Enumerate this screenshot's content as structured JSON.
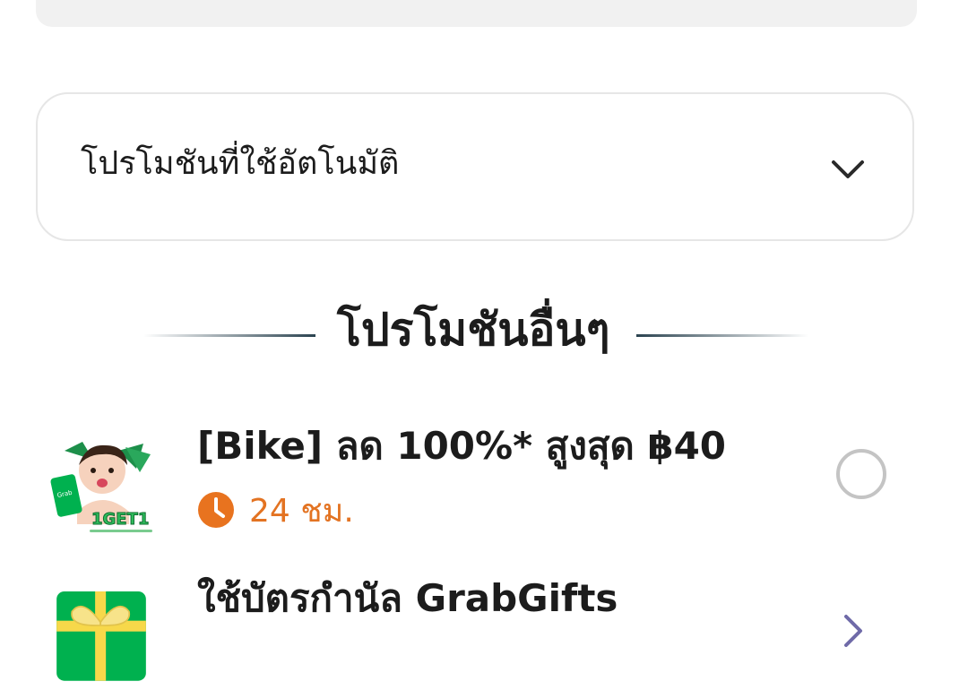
{
  "auto_promo": {
    "label": "โปรโมชันที่ใช้อัตโนมัติ"
  },
  "other_promos": {
    "title": "โปรโมชันอื่นๆ"
  },
  "promos": [
    {
      "title": "[Bike] ลด 100%* สูงสุด ฿40",
      "badge_text": "1GET1",
      "timer": "24 ชม.",
      "selected": false
    },
    {
      "title": "ใช้บัตรกำนัล GrabGifts"
    }
  ],
  "colors": {
    "timer_orange": "#e37322",
    "grab_green": "#00b14f",
    "radio_border": "#c4c4c4",
    "chevron_purple": "#6f6aa8"
  },
  "icons": {
    "auto_promo_toggle": "chevron-down-icon",
    "timer": "clock-icon",
    "promo_select": "radio-icon",
    "gift_open": "chevron-right-icon"
  }
}
